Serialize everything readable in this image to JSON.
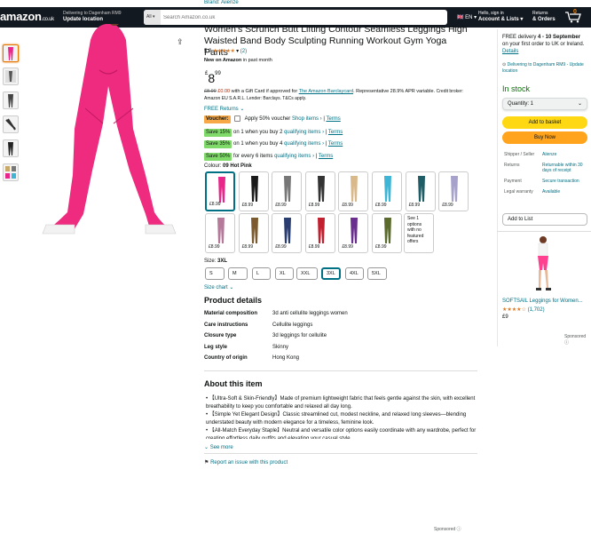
{
  "nav": {
    "logo": "amazon",
    "logo_tld": ".co.uk",
    "deliver_line1": "Delivering to Dagenham RM9",
    "deliver_line2": "Update location",
    "search_category": "All",
    "search_placeholder": "Search Amazon.co.uk",
    "language": "EN",
    "account_line1": "Hello, sign in",
    "account_line2": "Account & Lists",
    "returns_line1": "Returns",
    "returns_line2": "& Orders",
    "cart_count": "0",
    "cart_label": "Basket"
  },
  "brand": "Brand: Aiienze",
  "title": "Women's Scrunch Butt Lifting Contour Seamless Leggings High Waisted Band Body Sculpting Running Workout Gym Yoga Pants",
  "rating": {
    "value": "5.0",
    "stars": "★★★★★",
    "count": "(2)"
  },
  "new_on_amazon": "New on Amazon",
  "new_on_amazon_suffix": "in past month",
  "price": {
    "currency": "£",
    "whole": "8",
    "fraction": "99"
  },
  "gift_card": {
    "old_price": "£8.99",
    "new_price": "£0.00",
    "text1": "with a Gift Card if approved for",
    "link": "The Amazon Barclaycard",
    "text2": ". Representative 28.9% APR variable.",
    "broker": "Credit broker: Amazon EU S.A.R.L. Lender: Barclays. T&Cs apply."
  },
  "free_returns": "FREE Returns",
  "voucher": {
    "tag": "Voucher:",
    "text": "Apply 50% voucher",
    "shop": "Shop items ›",
    "sep": "|",
    "terms": "Terms"
  },
  "promos": [
    {
      "tag": "Save 15%",
      "text": "on 1 when you buy 2",
      "link": "qualifying items ›",
      "terms": "Terms"
    },
    {
      "tag": "Save 35%",
      "text": "on 1 when you buy 4",
      "link": "qualifying items ›",
      "terms": "Terms"
    },
    {
      "tag": "Save 50%",
      "text": "for every 6 items",
      "link": "qualifying items ›",
      "terms": "Terms"
    }
  ],
  "colour": {
    "label": "Colour:",
    "value": "09 Hot Pink"
  },
  "swatches": [
    {
      "price": "£8.99",
      "color": "#e8278b"
    },
    {
      "price": "£8.99",
      "color": "#1a1a1a"
    },
    {
      "price": "£8.99",
      "color": "#777777"
    },
    {
      "price": "£8.99",
      "color": "#333333"
    },
    {
      "price": "£8.99",
      "color": "#d9b98a"
    },
    {
      "price": "£8.99",
      "color": "#3fb5d6"
    },
    {
      "price": "£8.99",
      "color": "#1f5d66"
    },
    {
      "price": "£8.99",
      "color": "#a6a2cc"
    },
    {
      "price": "£8.99",
      "color": "#b57a9a"
    },
    {
      "price": "£8.99",
      "color": "#7a5a2e"
    },
    {
      "price": "£8.99",
      "color": "#2a3d70"
    },
    {
      "price": "£8.99",
      "color": "#c21f2f"
    },
    {
      "price": "£8.99",
      "color": "#6a2e8e"
    },
    {
      "price": "£8.99",
      "color": "#5b6b2e"
    }
  ],
  "no_featured_note": "See 1 options with no featured offers",
  "size": {
    "label": "Size:",
    "value": "3XL",
    "options": [
      "S",
      "M",
      "L",
      "XL",
      "XXL",
      "3XL",
      "4XL",
      "5XL"
    ],
    "chart_link": "Size chart"
  },
  "product_details": {
    "heading": "Product details",
    "rows": [
      {
        "k": "Material composition",
        "v": "3d anti cellulite leggings women"
      },
      {
        "k": "Care instructions",
        "v": "Cellulite leggings"
      },
      {
        "k": "Closure type",
        "v": "3d leggings for cellulite"
      },
      {
        "k": "Leg style",
        "v": "Skinny"
      },
      {
        "k": "Country of origin",
        "v": "Hong Kong"
      }
    ]
  },
  "about": {
    "heading": "About this item",
    "bullets": [
      "【Ultra-Soft & Skin-Friendly】Made of premium lightweight fabric that feels gentle against the skin, with excellent breathability to keep you comfortable and relaxed all day long.",
      "【Simple Yet Elegant Design】Classic streamlined cut, modest neckline, and relaxed long sleeves—blending understated beauty with modern elegance for a timeless, feminine look.",
      "【All-Match Everyday Staple】Neutral and versatile color options easily coordinate with any wardrobe, perfect for creating effortless daily outfits and elevating your casual style."
    ],
    "see_more": "See more"
  },
  "report": "Report an issue with this product",
  "sponsored": "Sponsored",
  "buybox": {
    "delivery1": "FREE delivery",
    "delivery_date": "4 - 10 September",
    "delivery2": "on your first order to UK or Ireland.",
    "details": "Details",
    "deliver_to": "Delivering to Dagenham RM9 - Update location",
    "in_stock": "In stock",
    "quantity": "Quantity: 1",
    "add_to_basket": "Add to basket",
    "buy_now": "Buy Now",
    "info": [
      {
        "k": "Shipper / Seller",
        "v": "Aiienze"
      },
      {
        "k": "Returns",
        "v": "Returnable within 30 days of receipt"
      },
      {
        "k": "Payment",
        "v": "Secure transaction"
      },
      {
        "k": "Legal warranty",
        "v": "Available"
      }
    ],
    "add_to_list": "Add to List"
  },
  "ad": {
    "title": "SOFTSAIL Leggings for Women...",
    "stars": "★★★★☆",
    "reviews": "(1,702)",
    "price": "£9"
  }
}
